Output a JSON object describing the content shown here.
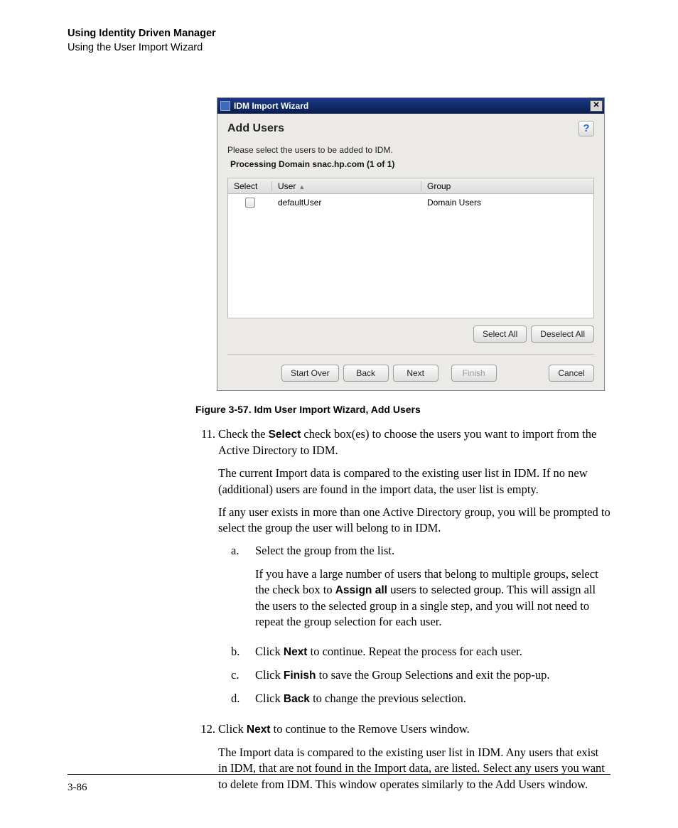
{
  "header": {
    "title": "Using Identity Driven Manager",
    "subtitle": "Using the User Import Wizard"
  },
  "dialog": {
    "window_title": "IDM Import Wizard",
    "heading": "Add Users",
    "instruction": "Please select the users to be added to IDM.",
    "processing": "Processing Domain snac.hp.com (1 of 1)",
    "columns": {
      "select": "Select",
      "user": "User",
      "group": "Group"
    },
    "rows": [
      {
        "user": "defaultUser",
        "group": "Domain Users"
      }
    ],
    "buttons": {
      "select_all": "Select All",
      "deselect_all": "Deselect All",
      "start_over": "Start Over",
      "back": "Back",
      "next": "Next",
      "finish": "Finish",
      "cancel": "Cancel"
    }
  },
  "figure_caption": "Figure 3-57. Idm User Import Wizard, Add Users",
  "step11": {
    "num": "11.",
    "intro_a": "Check the ",
    "intro_b": "Select",
    "intro_c": " check box(es) to choose the users you want to import from the Active Directory to IDM.",
    "p2": "The current Import data is compared to the existing user list in IDM. If no new (additional) users are found in the import data, the user list is empty.",
    "p3": "If any user exists in more than one Active Directory group, you will be prompted to select the group the user will belong to in IDM.",
    "a": {
      "letter": "a.",
      "line1": "Select the group from the list.",
      "line2_a": "If you have a large number of users that belong to multiple groups, select the check box to ",
      "line2_b": "Assign all",
      "line2_c": " users to selected group",
      "line2_d": ". This will assign all the users to the selected group in a single step, and you will not need to repeat the group selection for each user."
    },
    "b": {
      "letter": "b.",
      "pre": "Click ",
      "bold": "Next",
      "post": " to continue. Repeat the process for each user."
    },
    "c": {
      "letter": "c.",
      "pre": "Click ",
      "bold": "Finish",
      "post": " to save the Group Selections and exit the pop-up."
    },
    "d": {
      "letter": "d.",
      "pre": "Click ",
      "bold": "Back",
      "post": " to change the previous selection."
    }
  },
  "step12": {
    "num": "12.",
    "pre": "Click ",
    "bold": "Next",
    "post": " to continue to the Remove Users window.",
    "p2": "The Import data is compared to the existing user list in IDM. Any users that exist in IDM, that are not found in the Import data, are listed. Select any users you want to delete from IDM. This window operates similarly to the Add Users window."
  },
  "page_number": "3-86"
}
